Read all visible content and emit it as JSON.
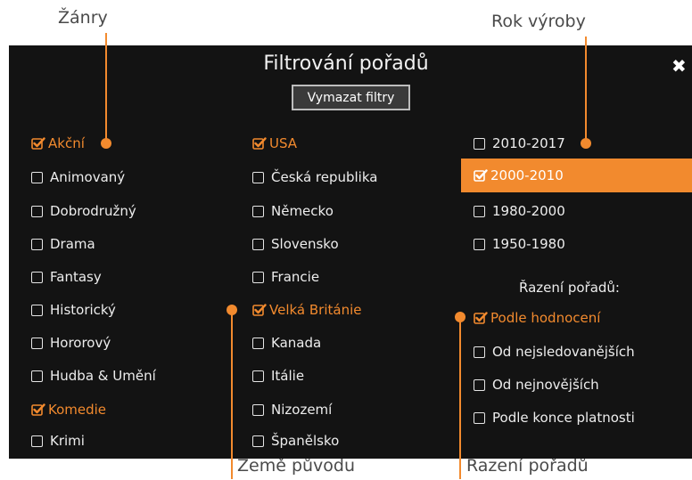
{
  "callouts": {
    "genres": "Žánry",
    "year": "Rok výroby",
    "origin": "Země původu",
    "sort": "Řazení pořadů"
  },
  "dialog": {
    "title": "Filtrování pořadů",
    "close_glyph": "✖",
    "clear_button": "Vymazat filtry"
  },
  "genres": [
    {
      "label": "Akční",
      "checked": true
    },
    {
      "label": "Animovaný",
      "checked": false
    },
    {
      "label": "Dobrodružný",
      "checked": false
    },
    {
      "label": "Drama",
      "checked": false
    },
    {
      "label": "Fantasy",
      "checked": false
    },
    {
      "label": "Historický",
      "checked": false
    },
    {
      "label": "Hororový",
      "checked": false
    },
    {
      "label": "Hudba & Umění",
      "checked": false
    },
    {
      "label": "Komedie",
      "checked": true
    },
    {
      "label": "Krimi",
      "checked": false
    }
  ],
  "countries": [
    {
      "label": "USA",
      "checked": true
    },
    {
      "label": "Česká republika",
      "checked": false
    },
    {
      "label": "Německo",
      "checked": false
    },
    {
      "label": "Slovensko",
      "checked": false
    },
    {
      "label": "Francie",
      "checked": false
    },
    {
      "label": "Velká Británie",
      "checked": true
    },
    {
      "label": "Kanada",
      "checked": false
    },
    {
      "label": "Itálie",
      "checked": false
    },
    {
      "label": "Nizozemí",
      "checked": false
    },
    {
      "label": "Španělsko",
      "checked": false
    }
  ],
  "years": [
    {
      "label": "2010-2017",
      "checked": false
    },
    {
      "label": "2000-2010",
      "checked": true
    },
    {
      "label": "1980-2000",
      "checked": false
    },
    {
      "label": "1950-1980",
      "checked": false
    }
  ],
  "sorting": {
    "heading": "Řazení pořadů:",
    "options": [
      {
        "label": "Podle hodnocení",
        "checked": true
      },
      {
        "label": "Od nejsledovanějších",
        "checked": false
      },
      {
        "label": "Od nejnovějších",
        "checked": false
      },
      {
        "label": "Podle konce platnosti",
        "checked": false
      }
    ]
  },
  "colors": {
    "accent": "#f28a2e",
    "panel_background": "#131313",
    "text": "#ededed"
  },
  "icons": {
    "checked": "checkmark-box-icon",
    "unchecked": "empty-checkbox-icon",
    "close": "close-icon"
  }
}
